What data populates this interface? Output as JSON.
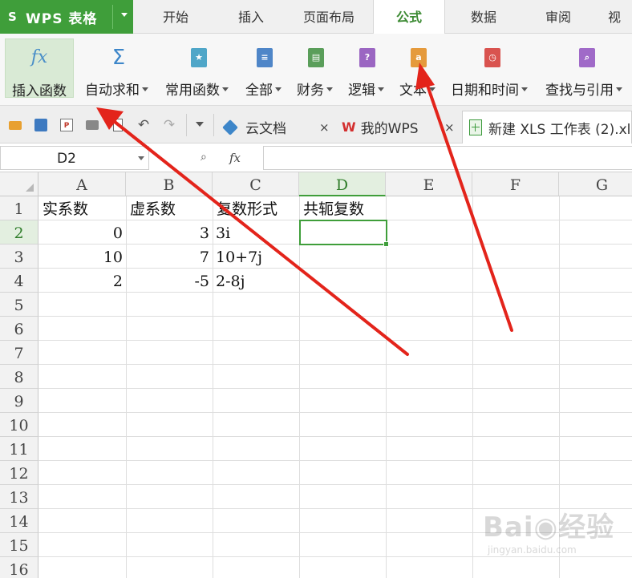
{
  "app": {
    "logo": "S",
    "name": "WPS 表格"
  },
  "menu_tabs": [
    "开始",
    "插入",
    "页面布局",
    "公式",
    "数据",
    "审阅",
    "视"
  ],
  "active_menu_tab": "公式",
  "ribbon": {
    "insert_function": {
      "icon": "fx",
      "label": "插入函数"
    },
    "groups": [
      {
        "label": "自动求和",
        "icon": "sigma-icon",
        "color": "#3d86c9"
      },
      {
        "label": "常用函数",
        "icon": "star-book-icon",
        "color": "#4fa6c8"
      },
      {
        "label": "全部",
        "icon": "list-book-icon",
        "color": "#4f86c8"
      },
      {
        "label": "财务",
        "icon": "money-book-icon",
        "color": "#5a9e5a"
      },
      {
        "label": "逻辑",
        "icon": "question-book-icon",
        "color": "#9b66c2"
      },
      {
        "label": "文本",
        "icon": "text-book-icon",
        "color": "#e59a3c"
      },
      {
        "label": "日期和时间",
        "icon": "clock-book-icon",
        "color": "#d9534f"
      },
      {
        "label": "查找与引用",
        "icon": "search-book-icon",
        "color": "#a06ac8"
      }
    ]
  },
  "toolbar": {
    "doc_tabs": [
      {
        "label": "云文档",
        "icon": "cloud-doc-icon"
      },
      {
        "label": "我的WPS",
        "icon": "wps-logo-icon",
        "logo_text": "W"
      },
      {
        "label": "新建 XLS 工作表 (2).xl",
        "icon": "xls-file-icon"
      }
    ],
    "close_glyph": "×"
  },
  "formula_bar": {
    "name_box": "D2",
    "fx_label": "fx",
    "formula": ""
  },
  "grid": {
    "columns": [
      "A",
      "B",
      "C",
      "D",
      "E",
      "F",
      "G"
    ],
    "rows": [
      "1",
      "2",
      "3",
      "4",
      "5",
      "6",
      "7",
      "8",
      "9",
      "10",
      "11",
      "12",
      "13",
      "14",
      "15",
      "16"
    ],
    "active_column": "D",
    "active_row": "2",
    "cells": {
      "A1": "实系数",
      "B1": "虚系数",
      "C1": "复数形式",
      "D1": "共轭复数",
      "A2": "0",
      "B2": "3",
      "C2": "3i",
      "A3": "10",
      "B3": "7",
      "C3": "10+7j",
      "A4": "2",
      "B4": "-5",
      "C4": "2-8j"
    }
  },
  "colors": {
    "brand_green": "#3f9e3a",
    "arrow_red": "#e3241b"
  },
  "watermark": {
    "brand": "Bai",
    "brand_cn": "经验",
    "url": "jingyan.baidu.com"
  }
}
